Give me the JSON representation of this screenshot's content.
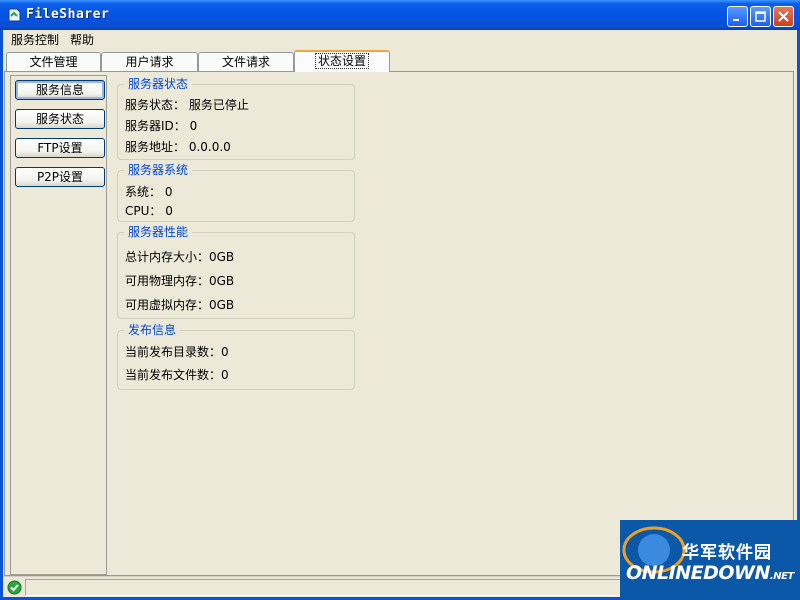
{
  "window": {
    "title": "FileSharer",
    "controls": {
      "minimize_icon": "minimize-icon",
      "maximize_icon": "maximize-icon",
      "close_icon": "close-icon"
    },
    "accent": "#0a5fe8"
  },
  "menu": {
    "items": [
      {
        "label": "服务控制"
      },
      {
        "label": "帮助"
      }
    ]
  },
  "tabs": [
    {
      "label": "文件管理",
      "active": false
    },
    {
      "label": "用户请求",
      "active": false
    },
    {
      "label": "文件请求",
      "active": false
    },
    {
      "label": "状态设置",
      "active": true
    }
  ],
  "sidebar": {
    "buttons": [
      {
        "label": "服务信息",
        "focused": true
      },
      {
        "label": "服务状态",
        "focused": false
      },
      {
        "label": "FTP设置",
        "focused": false
      },
      {
        "label": "P2P设置",
        "focused": false
      }
    ]
  },
  "groups": {
    "server_status": {
      "title": "服务器状态",
      "rows": [
        {
          "text": "服务状态：  服务已停止"
        },
        {
          "text": "服务器ID：  0"
        },
        {
          "text": "服务地址：  0.0.0.0"
        }
      ]
    },
    "server_system": {
      "title": "服务器系统",
      "rows": [
        {
          "text": "系统：  0"
        },
        {
          "text": "CPU：   0"
        }
      ]
    },
    "server_perf": {
      "title": "服务器性能",
      "rows": [
        {
          "text": "总计内存大小：0GB"
        },
        {
          "text": "可用物理内存：0GB"
        },
        {
          "text": "可用虚拟内存：0GB"
        }
      ]
    },
    "publish_info": {
      "title": "发布信息",
      "rows": [
        {
          "text": "当前发布目录数：0"
        },
        {
          "text": "当前发布文件数：0"
        }
      ]
    }
  },
  "statusbar": {
    "icon": "check-icon"
  },
  "watermark": {
    "cn": "华军软件园",
    "en": "ONLINEDOWN",
    "en_suffix": ".NET"
  },
  "colors": {
    "group_title": "#0046d5",
    "active_tab_top": "#f7a33c",
    "watermark_bg": "#0b58a8"
  }
}
